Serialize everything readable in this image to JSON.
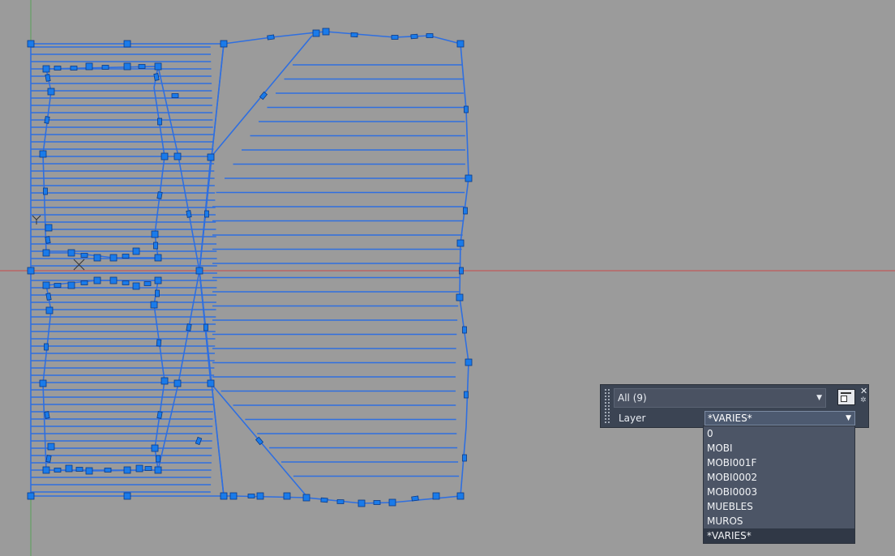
{
  "drawing": {
    "background": "#9b9b9b",
    "geometry_color": "#2f6fe0",
    "grip_color": "#1a7bea",
    "axis_x_color": "#c84a4a",
    "axis_y_color": "#5aa05a"
  },
  "quick_properties": {
    "filter": "All (9)",
    "layer_label": "Layer",
    "layer_value": "*VARIES*",
    "layer_options": [
      "0",
      "MOBI",
      "MOBI001F",
      "MOBI0002",
      "MOBI0003",
      "MUEBLES",
      "MUROS",
      "*VARIES*"
    ],
    "selected_option": "*VARIES*"
  }
}
